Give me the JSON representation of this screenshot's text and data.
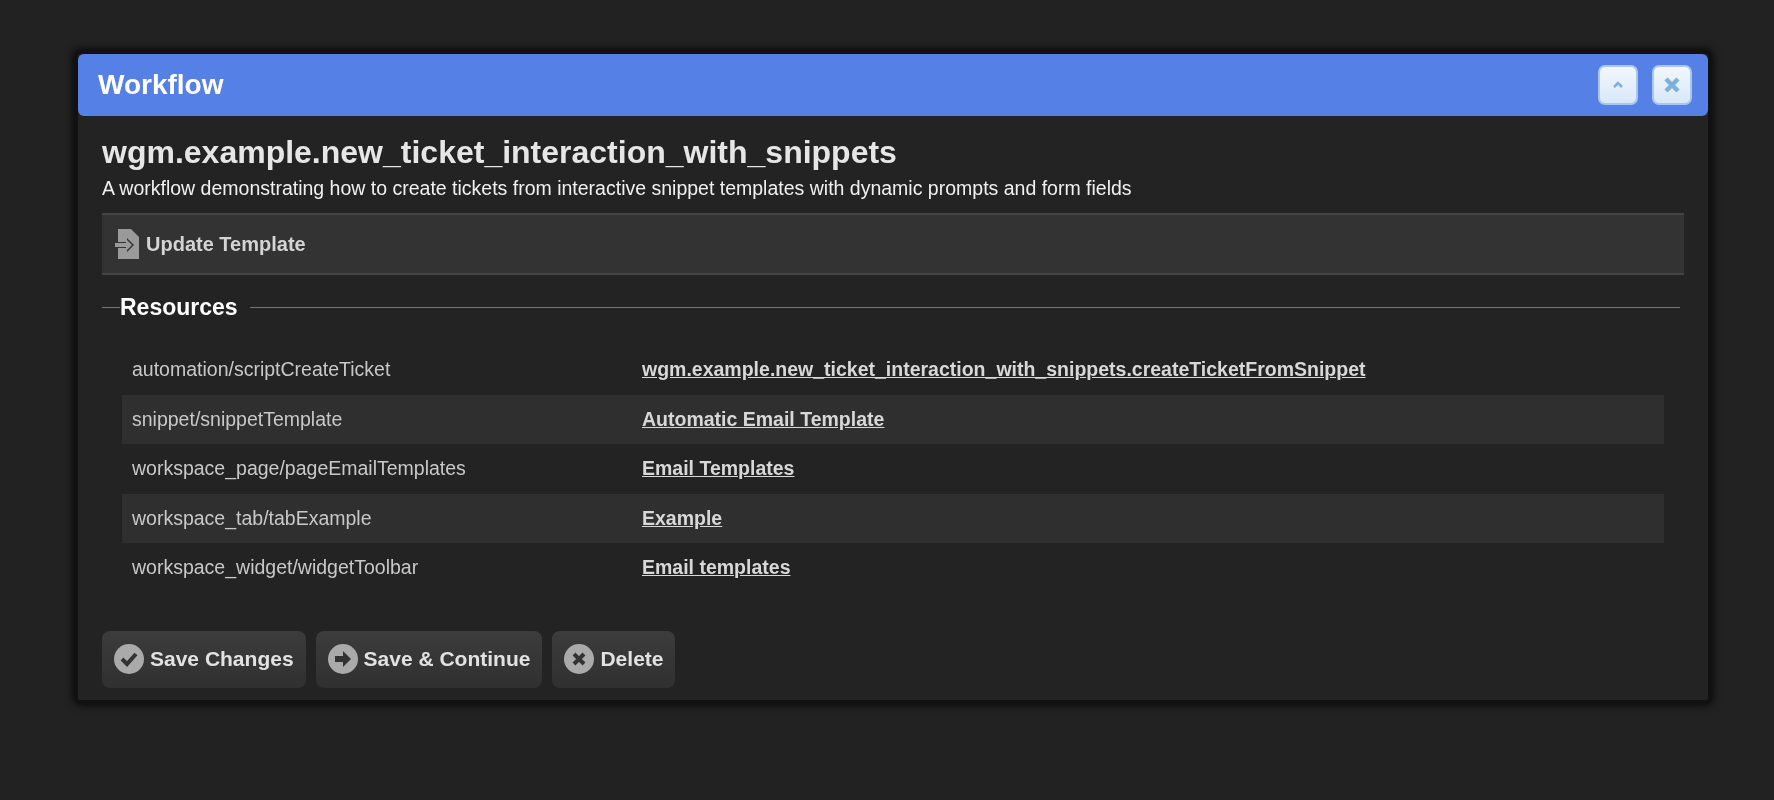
{
  "window": {
    "title": "Workflow"
  },
  "workflow": {
    "name": "wgm.example.new_ticket_interaction_with_snippets",
    "description": "A workflow demonstrating how to create tickets from interactive snippet templates with dynamic prompts and form fields"
  },
  "toolbar": {
    "items": [
      {
        "label": "Update Template"
      }
    ]
  },
  "resources": {
    "heading": "Resources",
    "rows": [
      {
        "path": "automation/scriptCreateTicket",
        "link": "wgm.example.new_ticket_interaction_with_snippets.createTicketFromSnippet"
      },
      {
        "path": "snippet/snippetTemplate",
        "link": "Automatic Email Template"
      },
      {
        "path": "workspace_page/pageEmailTemplates",
        "link": "Email Templates"
      },
      {
        "path": "workspace_tab/tabExample",
        "link": "Example"
      },
      {
        "path": "workspace_widget/widgetToolbar",
        "link": "Email templates"
      }
    ]
  },
  "buttons": [
    {
      "label": "Save Changes",
      "kind": "check"
    },
    {
      "label": "Save & Continue",
      "kind": "arrow"
    },
    {
      "label": "Delete",
      "kind": "delete"
    }
  ]
}
